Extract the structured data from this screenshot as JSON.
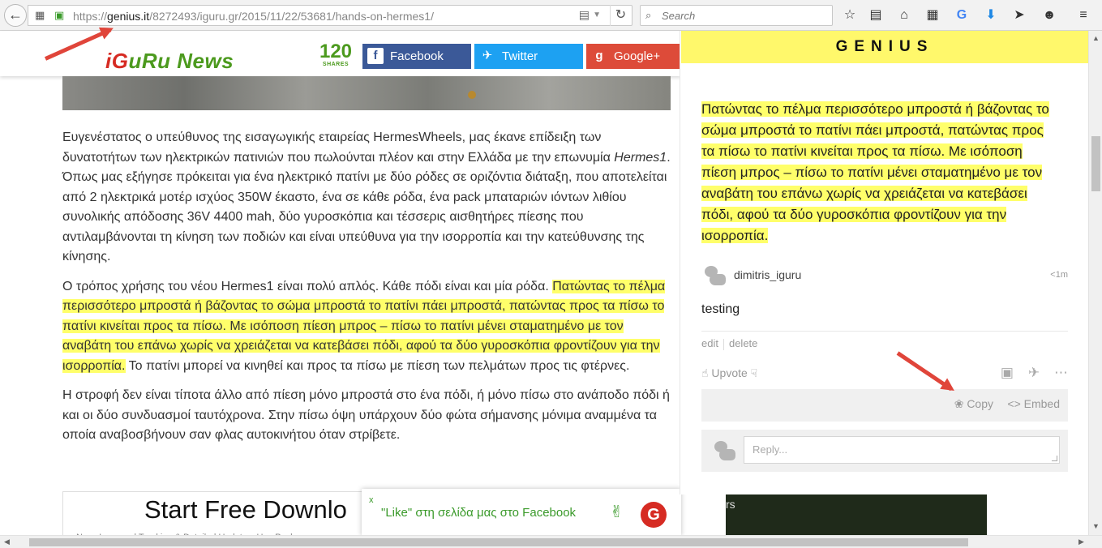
{
  "browser": {
    "url_scheme": "https://",
    "url_domain": "genius.it",
    "url_path": "/8272493/iguru.gr/2015/11/22/53681/hands-on-hermes1/",
    "search_placeholder": "Search"
  },
  "header": {
    "logo_prefix": "i",
    "logo_g": "G",
    "logo_rest": "uRu News",
    "share_count": "120",
    "share_label": "SHARES",
    "facebook": "Facebook",
    "twitter": "Twitter",
    "googleplus": "Google+"
  },
  "article": {
    "p1_text": "Ευγενέστατος ο υπεύθυνος της εισαγωγικής εταιρείας HermesWheels, μας έκανε επίδειξη των δυνατοτήτων των ηλεκτρικών πατινιών που πωλούνται πλέον και στην Ελλάδα με την επωνυμία ",
    "p1_em": "Hermes1",
    "p1_text2": ". Όπως μας εξήγησε πρόκειται για ένα ηλεκτρικό πατίνι με δύο ρόδες σε οριζόντια διάταξη, που αποτελείται από 2 ηλεκτρικά μοτέρ ισχύος 350W έκαστο, ένα σε κάθε ρόδα, ένα pack μπαταριών ιόντων λιθίου συνολικής απόδοσης 36V 4400 mah, δύο γυροσκόπια και τέσσερις αισθητήρες πίεσης που αντιλαμβάνονται τη κίνηση των ποδιών και είναι υπεύθυνα για την ισορροπία και την κατεύθυνσης της κίνησης.",
    "p2_text": "Ο τρόπος χρήσης του νέου Hermes1 είναι πολύ απλός. Κάθε πόδι είναι και μία ρόδα. ",
    "p2_highlight": "Πατώντας το πέλμα περισσότερο μπροστά ή  βάζοντας το σώμα μπροστά το πατίνι πάει μπροστά, πατώντας προς τα πίσω το πατίνι κινείται προς τα πίσω. Με ισόποση πίεση μπρος – πίσω το πατίνι μένει σταματημένο με τον αναβάτη του επάνω χωρίς να χρειάζεται να κατεβάσει πόδι, αφού τα δύο γυροσκόπια φροντίζουν για την ισορροπία.",
    "p2_text2": " Το πατίνι μπορεί να κινηθεί και προς τα πίσω με πίεση των πελμάτων προς τις φτέρνες.",
    "p3_text": "Η στροφή δεν είναι τίποτα άλλο από πίεση μόνο μπροστά στο ένα πόδι, ή μόνο πίσω στο ανάποδο πόδι ή και οι δύο συνδυασμοί ταυτόχρονα. Στην πίσω όψη υπάρχουν δύο φώτα σήμανσης μόνιμα αναμμένα τα οποία αναβοσβήνουν σαν φλας αυτοκινήτου όταν στρίβετε."
  },
  "ad": {
    "headline": "Start Free Downlo",
    "subline": "Now: Improved Tracking & Detailed Updates. Use Pack"
  },
  "like_bar": {
    "close": "x",
    "text": "\"Like\" στη σελίδα μας στο Facebook",
    "logo": "G"
  },
  "dark_ad": {
    "fragment": "rs"
  },
  "genius": {
    "title": "GENIUS",
    "annotation": "Πατώντας το πέλμα περισσότερο μπροστά ή βάζοντας το σώμα μπροστά το πατίνι πάει μπροστά, πατώντας προς τα πίσω το πατίνι κινείται προς τα πίσω. Με ισόποση πίεση μπρος – πίσω το πατίνι μένει σταματημένο με τον αναβάτη του επάνω χωρίς να χρειάζεται να κατεβάσει πόδι, αφού τα δύο γυροσκόπια φροντίζουν για την ισορροπία.",
    "username": "dimitris_iguru",
    "time": "<1m",
    "comment": "testing",
    "edit": "edit",
    "delete": "delete",
    "upvote": "Upvote",
    "copy": "Copy",
    "embed": "Embed",
    "reply_placeholder": "Reply..."
  },
  "colors": {
    "highlight": "#ffff6a",
    "genius_yellow": "#fff86b",
    "arrow_red": "#e0453a",
    "facebook": "#3b5998",
    "twitter": "#1da1f2",
    "googleplus": "#dd4b39",
    "brand_green": "#4c9a1e"
  }
}
